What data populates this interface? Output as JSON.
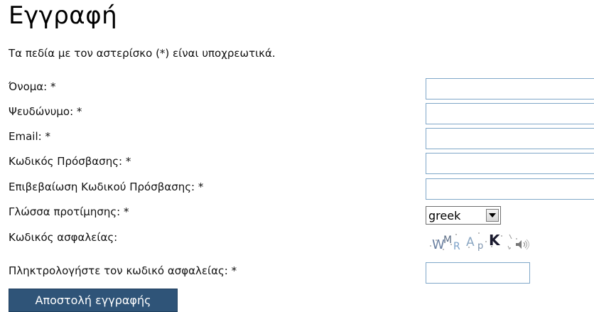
{
  "page": {
    "title": "Εγγραφή",
    "required_note": "Τα πεδία με τον αστερίσκο (*) είναι υποχρεωτικά."
  },
  "form": {
    "fields": {
      "name": {
        "label": "Όνομα: *",
        "value": ""
      },
      "username": {
        "label": "Ψευδώνυμο: *",
        "value": ""
      },
      "email": {
        "label": "Email: *",
        "value": ""
      },
      "password": {
        "label": "Κωδικός Πρόσβασης: *",
        "value": ""
      },
      "password_confirm": {
        "label": "Επιβεβαίωση Κωδικού Πρόσβασης: *",
        "value": ""
      },
      "language": {
        "label": "Γλώσσα προτίμησης: *",
        "selected": "greek"
      },
      "captcha": {
        "label": "Κωδικός ασφαλείας:",
        "image_text": "WMRApK"
      },
      "captcha_entry": {
        "label": "Πληκτρολογήστε τον κωδικό ασφαλείας: *",
        "value": ""
      }
    },
    "submit_label": "Αποστολή εγγραφής"
  },
  "icons": {
    "dropdown_arrow": "chevron-down-icon",
    "audio": "speaker-icon"
  },
  "colors": {
    "button_bg": "#2f5478",
    "input_border": "#7fa7c8"
  }
}
